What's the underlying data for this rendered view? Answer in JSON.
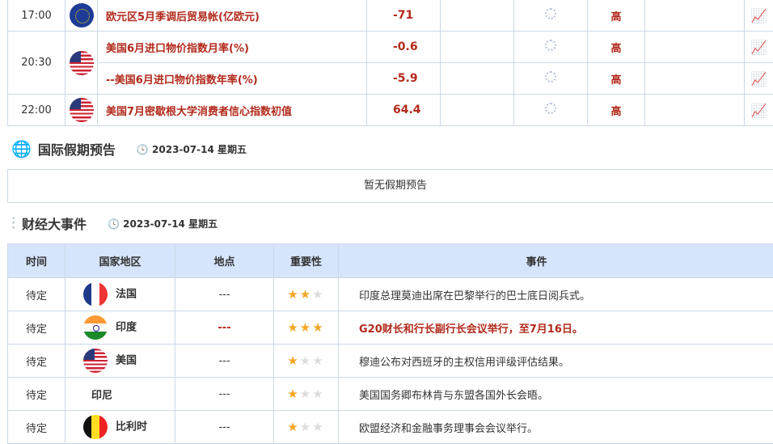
{
  "calendar": [
    {
      "time": "17:00",
      "flag": "eu",
      "event": "欧元区5月季调后贸易帐(亿欧元)",
      "value": "-71",
      "importance": "高"
    },
    {
      "time": "20:30",
      "flag": "us",
      "event": "美国6月进口物价指数月率(%)",
      "value": "-0.6",
      "importance": "高"
    },
    {
      "time": "",
      "flag": "",
      "event": "--美国6月进口物价指数年率(%)",
      "value": "-5.9",
      "importance": "高"
    },
    {
      "time": "22:00",
      "flag": "us",
      "event": "美国7月密歇根大学消费者信心指数初值",
      "value": "64.4",
      "importance": "高"
    }
  ],
  "holiday": {
    "title": "国际假期预告",
    "date": "2023-07-14 星期五",
    "empty": "暂无假期预告"
  },
  "events": {
    "title": "财经大事件",
    "date": "2023-07-14 星期五",
    "headers": [
      "时间",
      "国家地区",
      "地点",
      "重要性",
      "事件"
    ],
    "rows": [
      {
        "time": "待定",
        "country": "法国",
        "place": "---",
        "stars": 2,
        "event": "印度总理莫迪出席在巴黎举行的巴士底日阅兵式。"
      },
      {
        "time": "待定",
        "country": "印度",
        "place": "---",
        "stars": 3,
        "event": "G20财长和行长副行长会议举行，至7月16日。"
      },
      {
        "time": "待定",
        "country": "美国",
        "place": "---",
        "stars": 1,
        "event": "穆迪公布对西班牙的主权信用评级评估结果。"
      },
      {
        "time": "待定",
        "country": "印尼",
        "place": "---",
        "stars": 1,
        "event": "美国国务卿布林肯与东盟各国外长会晤。"
      },
      {
        "time": "待定",
        "country": "比利时",
        "place": "---",
        "stars": 1,
        "event": "欧盟经济和金融事务理事会会议举行。"
      }
    ]
  }
}
